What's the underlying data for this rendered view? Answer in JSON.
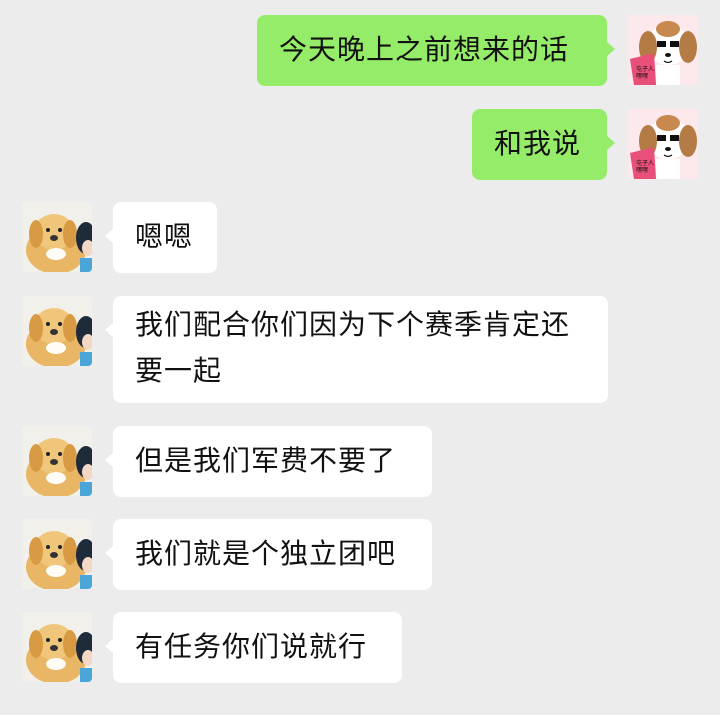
{
  "messages": [
    {
      "side": "sent",
      "text": "今天晚上之前想来的话",
      "avatar": "dog-reading-book-avatar"
    },
    {
      "side": "sent",
      "text": "和我说",
      "avatar": "dog-reading-book-avatar"
    },
    {
      "side": "recv",
      "text": "嗯嗯",
      "avatar": "golden-dog-with-girl-avatar"
    },
    {
      "side": "recv",
      "text": "我们配合你们因为下个赛季肯定还要一起",
      "avatar": "golden-dog-with-girl-avatar"
    },
    {
      "side": "recv",
      "text": "但是我们军费不要了",
      "avatar": "golden-dog-with-girl-avatar"
    },
    {
      "side": "recv",
      "text": "我们就是个独立团吧",
      "avatar": "golden-dog-with-girl-avatar"
    },
    {
      "side": "recv",
      "text": "有任务你们说就行",
      "avatar": "golden-dog-with-girl-avatar"
    }
  ],
  "colors": {
    "background": "#ececec",
    "sent_bubble": "#95ec69",
    "recv_bubble": "#ffffff"
  },
  "book_text": "屯子人 嘿嘿嘿"
}
